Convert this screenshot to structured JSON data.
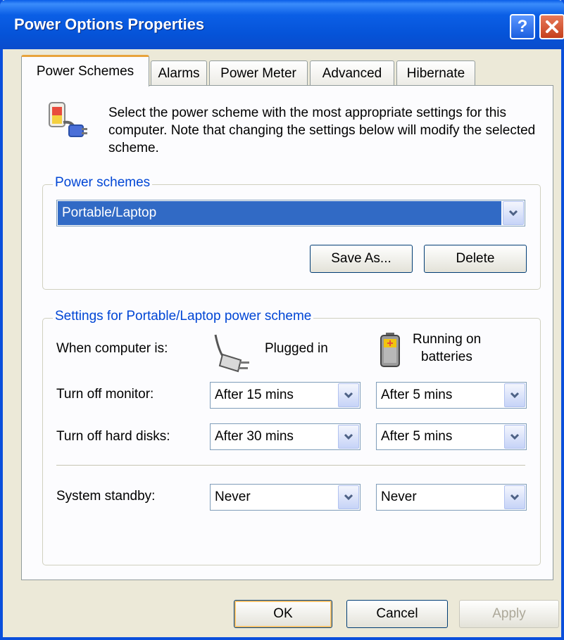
{
  "window": {
    "title": "Power Options Properties"
  },
  "tabs": [
    {
      "label": "Power Schemes"
    },
    {
      "label": "Alarms"
    },
    {
      "label": "Power Meter"
    },
    {
      "label": "Advanced"
    },
    {
      "label": "Hibernate"
    }
  ],
  "intro": "Select the power scheme with the most appropriate settings for this computer. Note that changing the settings below will modify the selected scheme.",
  "power_schemes": {
    "group_label": "Power schemes",
    "selected": "Portable/Laptop",
    "save_as_label": "Save As...",
    "delete_label": "Delete"
  },
  "settings": {
    "group_label": "Settings for Portable/Laptop power scheme",
    "when_label": "When computer is:",
    "plugged_in_label": "Plugged in",
    "batteries_label_line1": "Running on",
    "batteries_label_line2": "batteries",
    "rows": [
      {
        "label": "Turn off monitor:",
        "plugged": "After 15 mins",
        "battery": "After 5 mins"
      },
      {
        "label": "Turn off hard disks:",
        "plugged": "After 30 mins",
        "battery": "After 5 mins"
      },
      {
        "label": "System standby:",
        "plugged": "Never",
        "battery": "Never"
      }
    ]
  },
  "buttons": {
    "ok": "OK",
    "cancel": "Cancel",
    "apply": "Apply"
  },
  "colors": {
    "titlebar": "#0553d8",
    "selection": "#316ac5",
    "group_label": "#0046d5"
  }
}
